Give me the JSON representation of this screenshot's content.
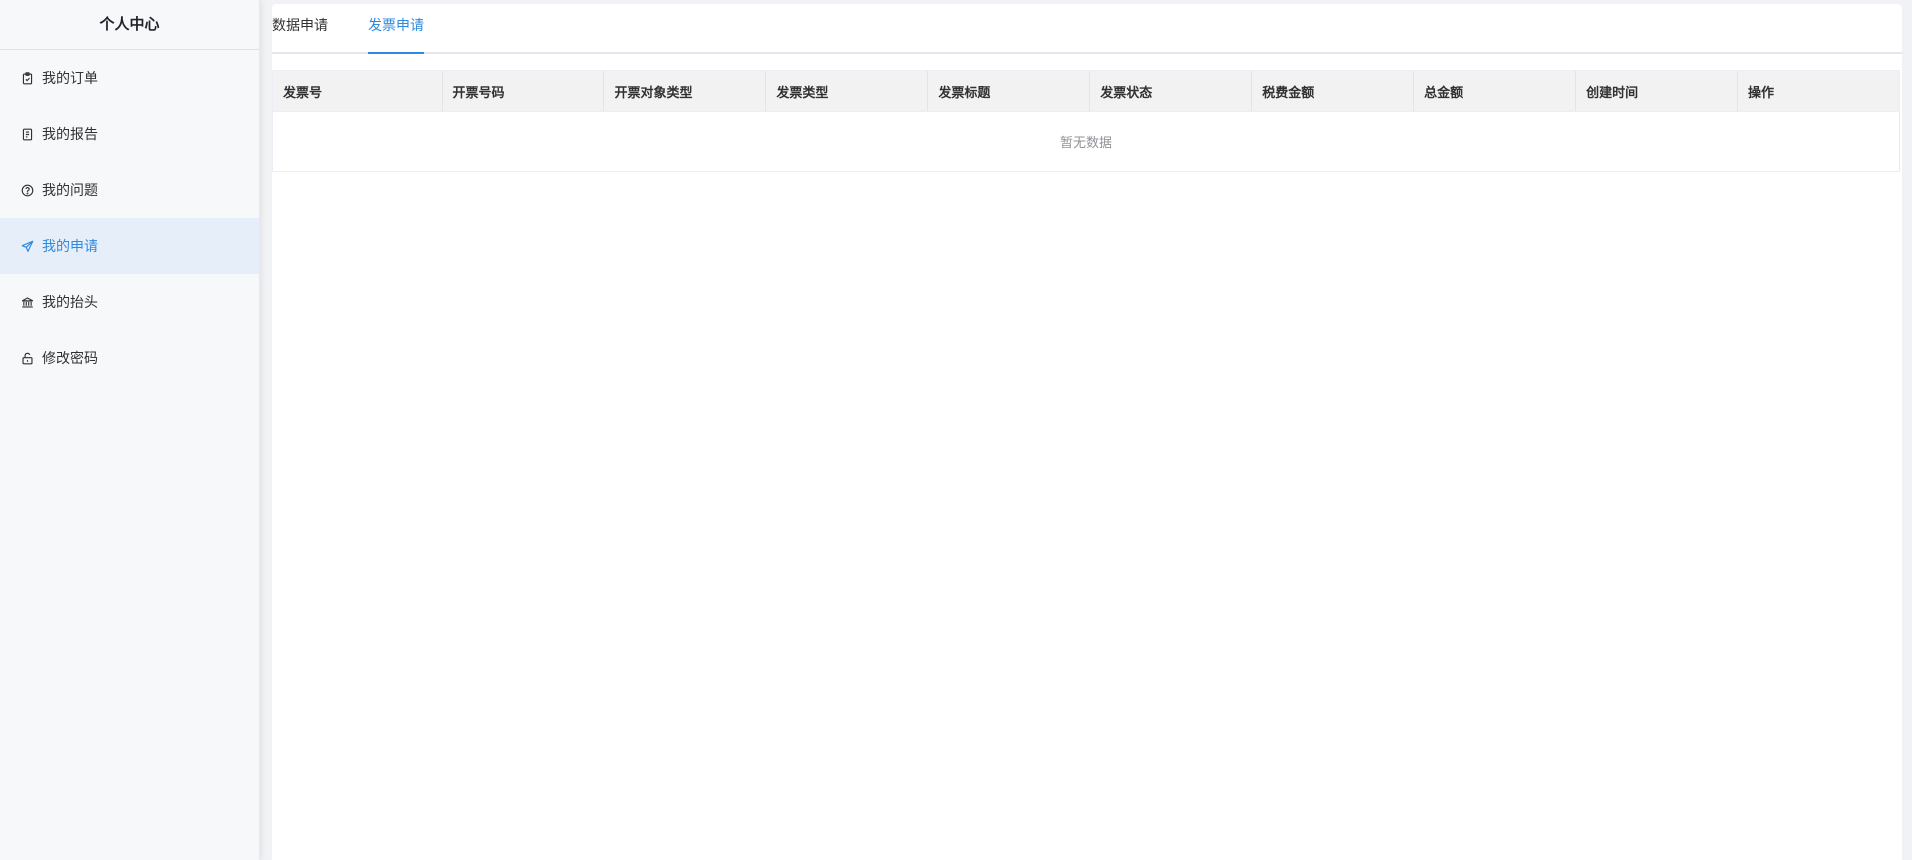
{
  "sidebar": {
    "title": "个人中心",
    "items": [
      {
        "label": "我的订单",
        "icon": "clipboard-icon",
        "active": false
      },
      {
        "label": "我的报告",
        "icon": "report-icon",
        "active": false
      },
      {
        "label": "我的问题",
        "icon": "question-circle-icon",
        "active": false
      },
      {
        "label": "我的申请",
        "icon": "send-icon",
        "active": true
      },
      {
        "label": "我的抬头",
        "icon": "bank-icon",
        "active": false
      },
      {
        "label": "修改密码",
        "icon": "unlock-icon",
        "active": false
      }
    ]
  },
  "tabs": [
    {
      "label": "数据申请",
      "active": false
    },
    {
      "label": "发票申请",
      "active": true
    }
  ],
  "table": {
    "columns": [
      "发票号",
      "开票号码",
      "开票对象类型",
      "发票类型",
      "发票标题",
      "发票状态",
      "税费金额",
      "总金额",
      "创建时间",
      "操作"
    ],
    "empty_text": "暂无数据"
  },
  "colors": {
    "accent": "#2d8ae0",
    "active_bg": "#e6eef9",
    "header_bg": "#f2f2f2"
  }
}
